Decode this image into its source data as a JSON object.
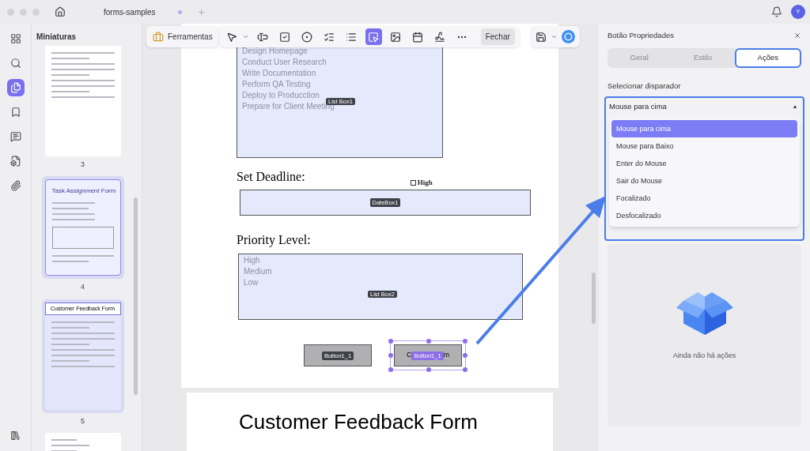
{
  "window": {
    "tab_title": "forms-samples",
    "avatar": "Y"
  },
  "rail": [
    {
      "kind": "grid",
      "selected": false
    },
    {
      "kind": "search",
      "selected": false
    },
    {
      "kind": "pages",
      "selected": true
    },
    {
      "kind": "bookmark",
      "selected": false
    },
    {
      "kind": "comment",
      "selected": false
    },
    {
      "kind": "form",
      "selected": false
    },
    {
      "kind": "attachment",
      "selected": false
    }
  ],
  "thumbnails": {
    "title": "Miniaturas",
    "pages": [
      {
        "number": "3",
        "highlighted": false,
        "kind": "form"
      },
      {
        "number": "4",
        "highlighted": true,
        "kind": "task",
        "title": "Task Assignment Form"
      },
      {
        "number": "5",
        "highlighted": true,
        "kind": "feedback",
        "title": "Customer Feedback Form"
      },
      {
        "kind": "invoice",
        "highlighted": false
      }
    ]
  },
  "toolbar": {
    "tools_label": "Ferramentas",
    "tools": [
      {
        "kind": "select",
        "selected": false
      },
      {
        "kind": "text-field",
        "selected": false
      },
      {
        "kind": "checkbox",
        "selected": false
      },
      {
        "kind": "radio",
        "selected": false
      },
      {
        "kind": "combo-box",
        "selected": false
      },
      {
        "kind": "list-box",
        "selected": false
      },
      {
        "kind": "button",
        "selected": true
      },
      {
        "kind": "image",
        "selected": false
      },
      {
        "kind": "date",
        "selected": false
      },
      {
        "kind": "signature",
        "selected": false
      },
      {
        "kind": "more",
        "selected": false
      }
    ],
    "close_label": "Fechar"
  },
  "document": {
    "list_box_1": {
      "items": [
        "Design Homepage",
        "Conduct User Research",
        "Write Documentation",
        "Perform QA Testing",
        "Deploy to Producction",
        "Prepare for Client Meeting"
      ],
      "tag": "List Box1"
    },
    "deadline_label": "Set Deadline:",
    "checkbox": {
      "label": "High",
      "checked": false
    },
    "date_box": {
      "tag": "DateBox1"
    },
    "priority_label": "Priority Level:",
    "list_box_2": {
      "items": [
        "High",
        "Medium",
        "Low"
      ],
      "tag": "List Box2"
    },
    "buttons": [
      {
        "tag": "Button1_1",
        "selected": false
      },
      {
        "tag": "Button1_1",
        "selected": true,
        "text_before": "C",
        "text_after": "m"
      }
    ],
    "next_page_title": "Customer Feedback Form"
  },
  "properties": {
    "title": "Botão Propriedades",
    "tabs": [
      {
        "label": "Geral",
        "selected": false
      },
      {
        "label": "Estilo",
        "selected": false
      },
      {
        "label": "Ações",
        "selected": true
      }
    ],
    "trigger_label": "Selecionar disparador",
    "trigger_value": "Mouse para cima",
    "options": [
      {
        "label": "Mouse para cima",
        "selected": true
      },
      {
        "label": "Mouse para Baixo",
        "selected": false
      },
      {
        "label": "Enter do Mouse",
        "selected": false
      },
      {
        "label": "Sair do Mouse",
        "selected": false
      },
      {
        "label": "Focalizado",
        "selected": false
      },
      {
        "label": "Desfocalizado",
        "selected": false
      }
    ],
    "empty_message": "Ainda não há ações"
  }
}
